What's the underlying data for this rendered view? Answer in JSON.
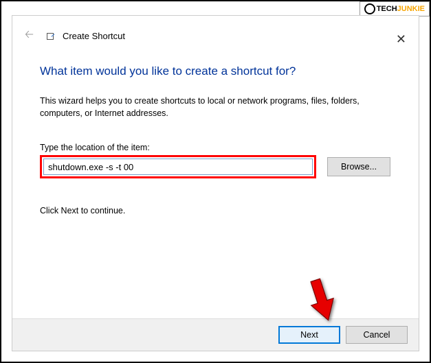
{
  "logo": {
    "brand_prefix": "TECH",
    "brand_suffix": "JUNKIE"
  },
  "header": {
    "title": "Create Shortcut",
    "back_aria": "Back"
  },
  "close_symbol": "✕",
  "main": {
    "question": "What item would you like to create a shortcut for?",
    "description": "This wizard helps you to create shortcuts to local or network programs, files, folders, computers, or Internet addresses.",
    "location_label": "Type the location of the item:",
    "location_value": "shutdown.exe -s -t 00",
    "browse_label": "Browse...",
    "continue_text": "Click Next to continue."
  },
  "footer": {
    "next_label": "Next",
    "cancel_label": "Cancel"
  }
}
